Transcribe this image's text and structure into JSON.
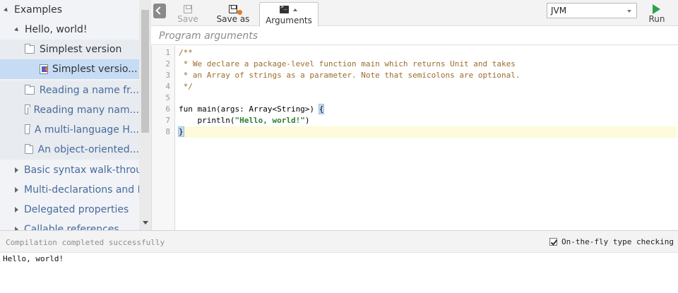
{
  "sidebar": {
    "items": [
      {
        "label": "Examples",
        "kind": "folder-open",
        "level": 0
      },
      {
        "label": "Hello, world!",
        "kind": "folder-open",
        "level": 1
      },
      {
        "label": "Simplest version",
        "kind": "folder-icon",
        "level": 2
      },
      {
        "label": "Simplest versio...",
        "kind": "kotlin-file",
        "level": 3,
        "selected": true
      },
      {
        "label": "Reading a name fr...",
        "kind": "folder-icon",
        "level": 2
      },
      {
        "label": "Reading many nam...",
        "kind": "folder-icon",
        "level": 2
      },
      {
        "label": "A multi-language H...",
        "kind": "folder-icon",
        "level": 2
      },
      {
        "label": "An object-oriented...",
        "kind": "folder-icon",
        "level": 2
      },
      {
        "label": "Basic syntax walk-throug",
        "kind": "folder-closed",
        "level": 1
      },
      {
        "label": "Multi-declarations and D",
        "kind": "folder-closed",
        "level": 1
      },
      {
        "label": "Delegated properties",
        "kind": "folder-closed",
        "level": 1
      },
      {
        "label": "Callable references",
        "kind": "folder-closed",
        "level": 1
      }
    ]
  },
  "toolbar": {
    "save_label": "Save",
    "save_as_label": "Save as",
    "arguments_label": "Arguments",
    "target_value": "JVM",
    "run_label": "Run"
  },
  "args": {
    "placeholder": "Program arguments"
  },
  "editor": {
    "line_numbers": [
      "1",
      "2",
      "3",
      "4",
      "5",
      "6",
      "7",
      "8"
    ],
    "lines": {
      "l1": "/**",
      "l2": " * We declare a package-level function main which returns Unit and takes",
      "l3": " * an Array of strings as a parameter. Note that semicolons are optional.",
      "l4": " */",
      "l5": "",
      "l6_a": "fun main(args: Array<String>) ",
      "l6_b": "{",
      "l7_a": "    println(",
      "l7_b": "\"Hello, world!\"",
      "l7_c": ")",
      "l8": "}"
    },
    "active_line": 8
  },
  "status": {
    "message": "Compilation completed successfully",
    "typecheck_label": "On-the-fly type checking",
    "typecheck_checked": true
  },
  "output": {
    "text": "Hello, world!"
  }
}
